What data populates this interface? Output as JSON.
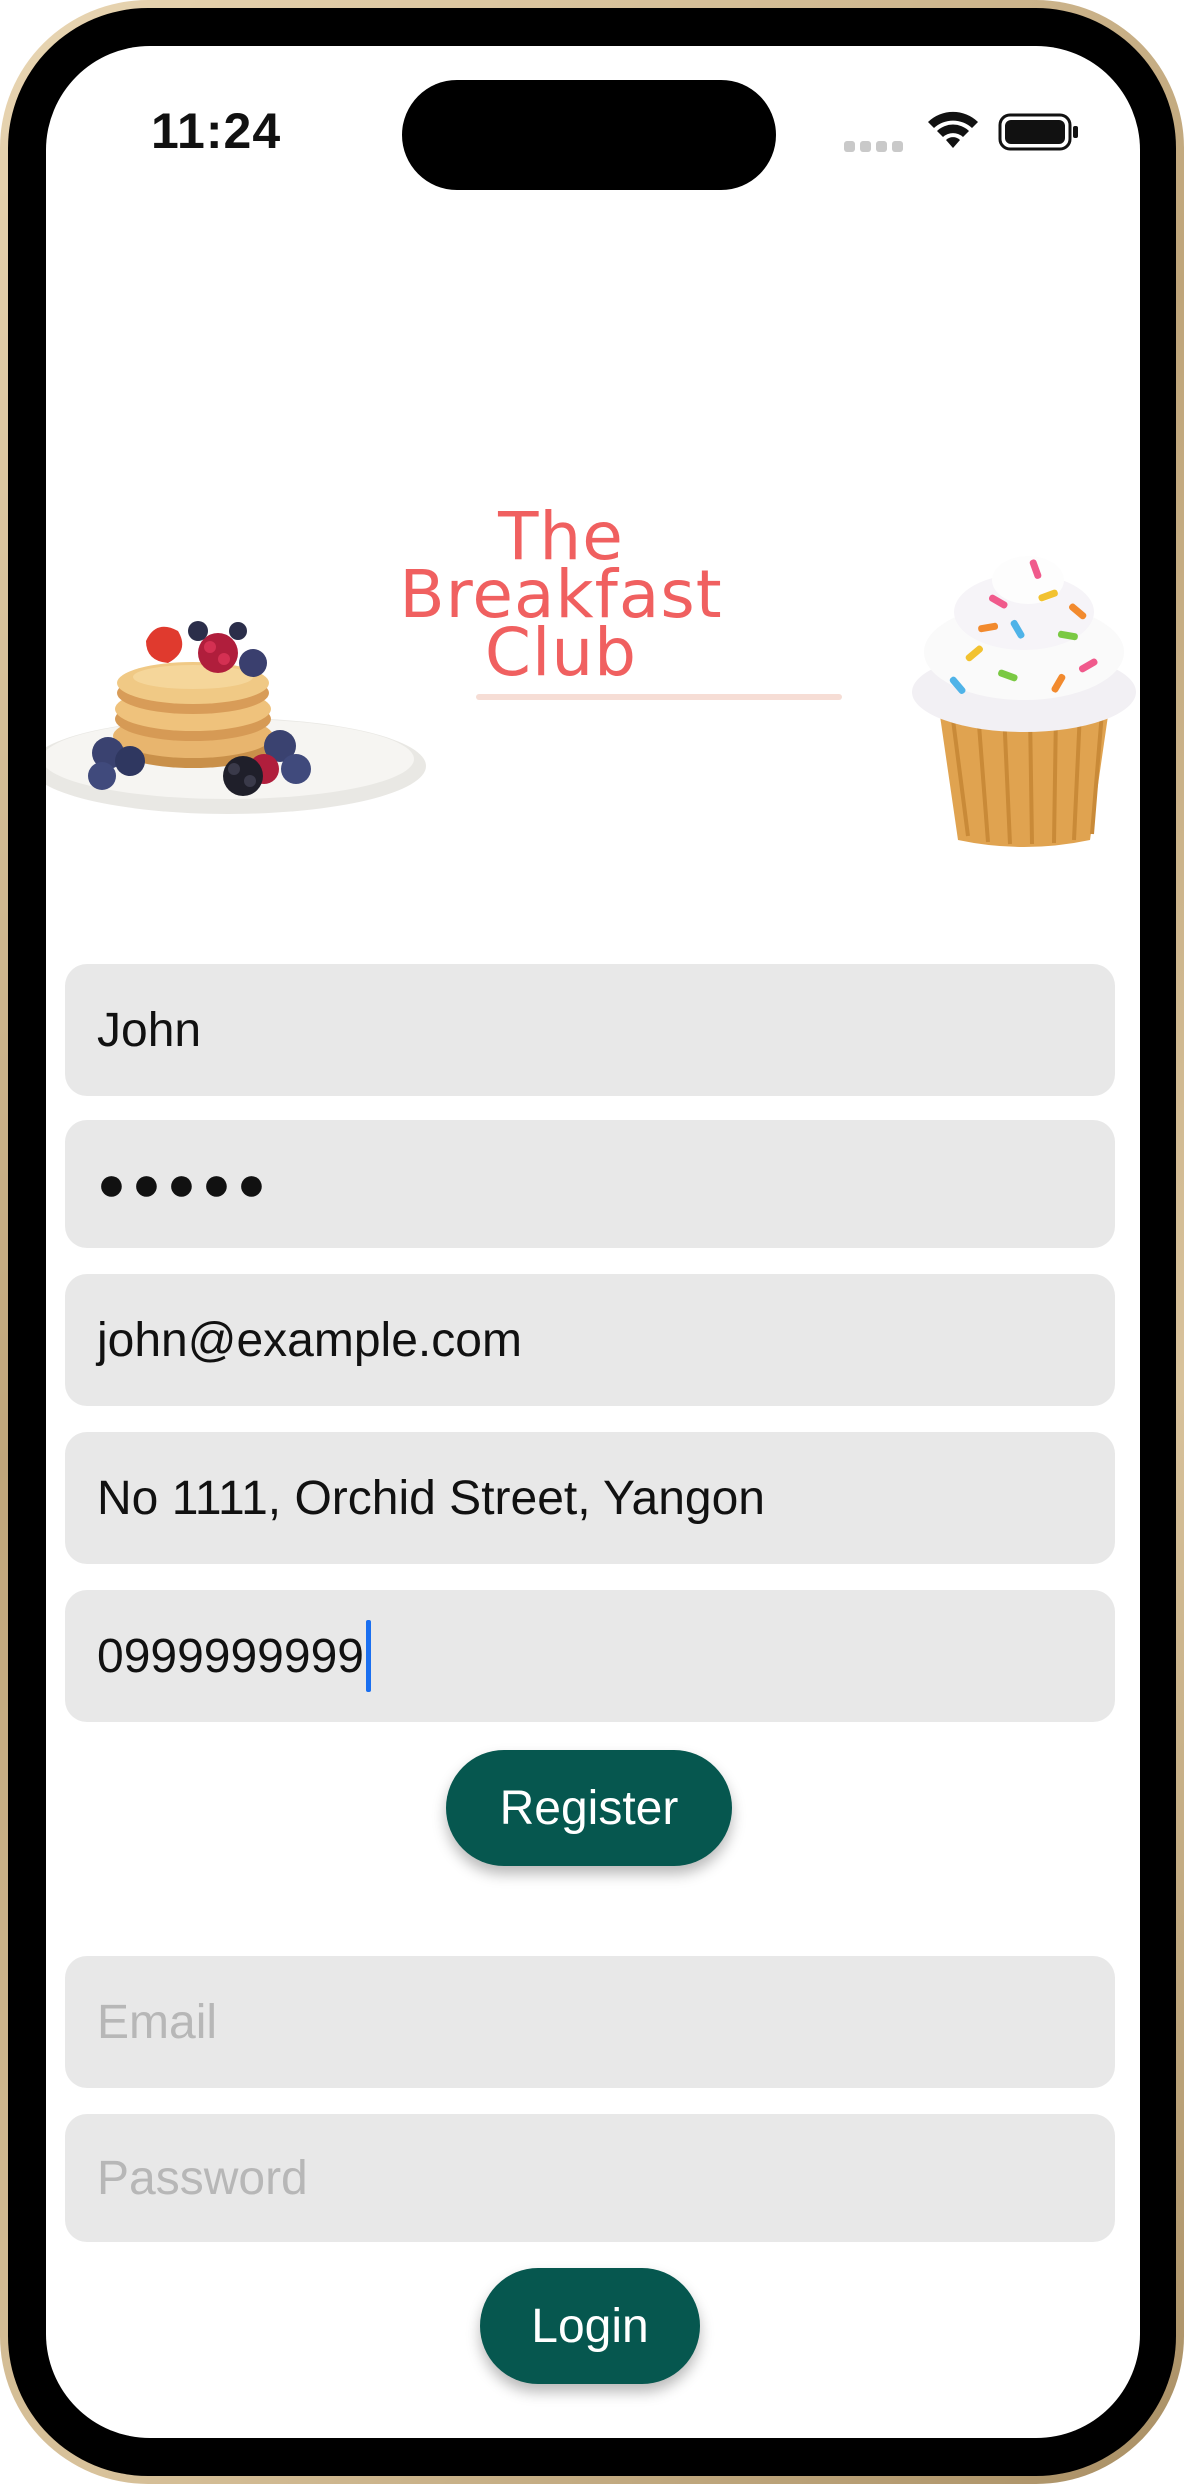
{
  "status_bar": {
    "time": "11:24"
  },
  "brand": {
    "title_line1": "The Breakfast",
    "title_line2": "Club"
  },
  "images": {
    "left": "pancakes-image",
    "right": "cupcake-image"
  },
  "register_form": {
    "name_value": "John",
    "password_mask": "●●●●●",
    "email_value": "john@example.com",
    "address_value": "No 1111, Orchid Street, Yangon",
    "phone_value": "0999999999",
    "register_label": "Register"
  },
  "login_form": {
    "email_placeholder": "Email",
    "password_placeholder": "Password",
    "login_label": "Login"
  },
  "colors": {
    "accent": "#06574f",
    "brand": "#f06060",
    "field_bg": "#e8e8e8",
    "caret": "#1a6ff0"
  }
}
